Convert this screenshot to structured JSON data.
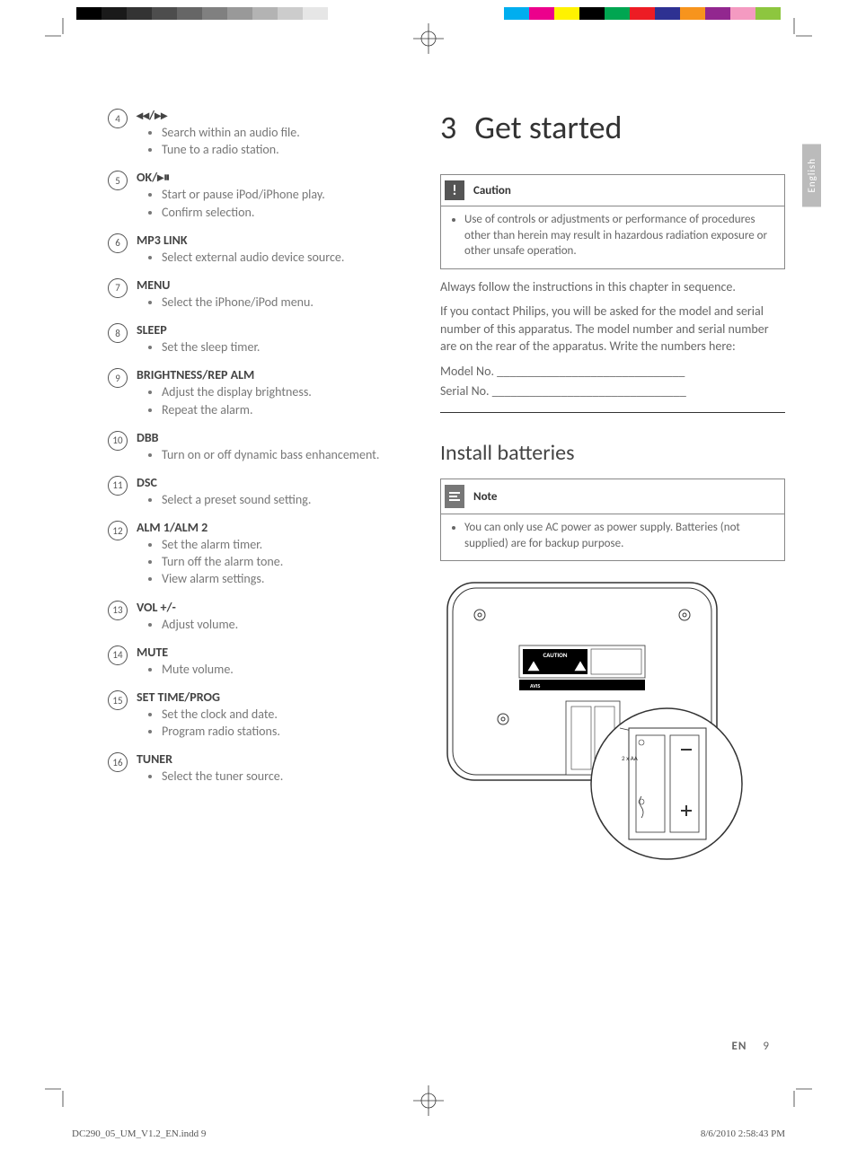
{
  "lang_tab": "English",
  "left_items": [
    {
      "num": "4",
      "title_glyph": "◂◂/▸▸",
      "title": "",
      "bullets": [
        "Search within an audio file.",
        "Tune to a radio station."
      ]
    },
    {
      "num": "5",
      "title_glyph": "",
      "title": "OK/▸⏸",
      "bullets": [
        "Start or pause iPod/iPhone play.",
        "Confirm selection."
      ]
    },
    {
      "num": "6",
      "title_glyph": "",
      "title": "MP3 LINK",
      "bullets": [
        "Select external audio device source."
      ]
    },
    {
      "num": "7",
      "title_glyph": "",
      "title": "MENU",
      "bullets": [
        "Select the iPhone/iPod menu."
      ]
    },
    {
      "num": "8",
      "title_glyph": "",
      "title": "SLEEP",
      "bullets": [
        "Set the sleep timer."
      ]
    },
    {
      "num": "9",
      "title_glyph": "",
      "title": "BRIGHTNESS/REP ALM",
      "bullets": [
        "Adjust the display brightness.",
        "Repeat the alarm."
      ]
    },
    {
      "num": "10",
      "title_glyph": "",
      "title": "DBB",
      "bullets": [
        "Turn on or off dynamic bass enhancement."
      ]
    },
    {
      "num": "11",
      "title_glyph": "",
      "title": "DSC",
      "bullets": [
        "Select a preset sound setting."
      ]
    },
    {
      "num": "12",
      "title_glyph": "",
      "title": "ALM 1/ALM 2",
      "bullets": [
        "Set the alarm timer.",
        "Turn off the alarm tone.",
        "View alarm settings."
      ]
    },
    {
      "num": "13",
      "title_glyph": "",
      "title": "VOL +/-",
      "bullets": [
        "Adjust volume."
      ]
    },
    {
      "num": "14",
      "title_glyph": "",
      "title": "MUTE",
      "bullets": [
        "Mute volume."
      ]
    },
    {
      "num": "15",
      "title_glyph": "",
      "title": "SET TIME/PROG",
      "bullets": [
        "Set the clock and date.",
        "Program radio stations."
      ]
    },
    {
      "num": "16",
      "title_glyph": "",
      "title": "TUNER",
      "bullets": [
        "Select the tuner source."
      ]
    }
  ],
  "chapter": {
    "num": "3",
    "title": "Get started"
  },
  "caution": {
    "label": "Caution",
    "text": "Use of controls or adjustments or performance of procedures other than herein may result in hazardous radiation exposure or other unsafe operation."
  },
  "paras": [
    "Always follow the instructions in this chapter in sequence.",
    "If you contact Philips, you will be asked for the model and serial number of this apparatus. The model number and serial number are on the rear of the apparatus. Write the numbers here:",
    "Model No. ______________________________",
    "Serial No. _______________________________"
  ],
  "section2": "Install batteries",
  "note": {
    "label": "Note",
    "text": "You can only use AC power as power supply. Batteries (not supplied) are for backup purpose."
  },
  "illustration_labels": {
    "caution_box": "CAUTION",
    "avis": "AVIS",
    "batt": "2 x AA"
  },
  "footer": {
    "lang": "EN",
    "page": "9"
  },
  "slug": {
    "file": "DC290_05_UM_V1.2_EN.indd   9",
    "timestamp": "8/6/2010   2:58:43 PM"
  }
}
